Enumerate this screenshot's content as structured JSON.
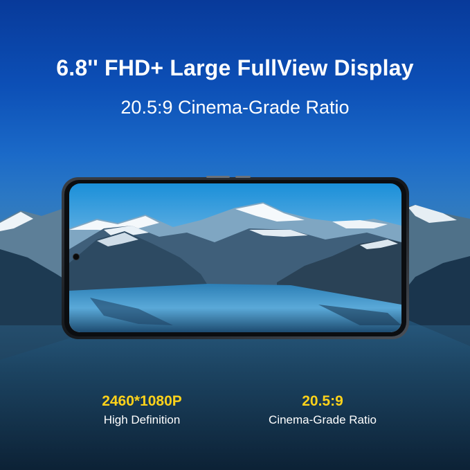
{
  "headline": "6.8'' FHD+ Large FullView Display",
  "subheadline": "20.5:9 Cinema-Grade Ratio",
  "specs": [
    {
      "value": "2460*1080P",
      "label": "High Definition"
    },
    {
      "value": "20.5:9",
      "label": "Cinema-Grade Ratio"
    }
  ],
  "colors": {
    "accent": "#ffd21a",
    "text": "#ffffff",
    "sky_top": "#083a9a"
  }
}
